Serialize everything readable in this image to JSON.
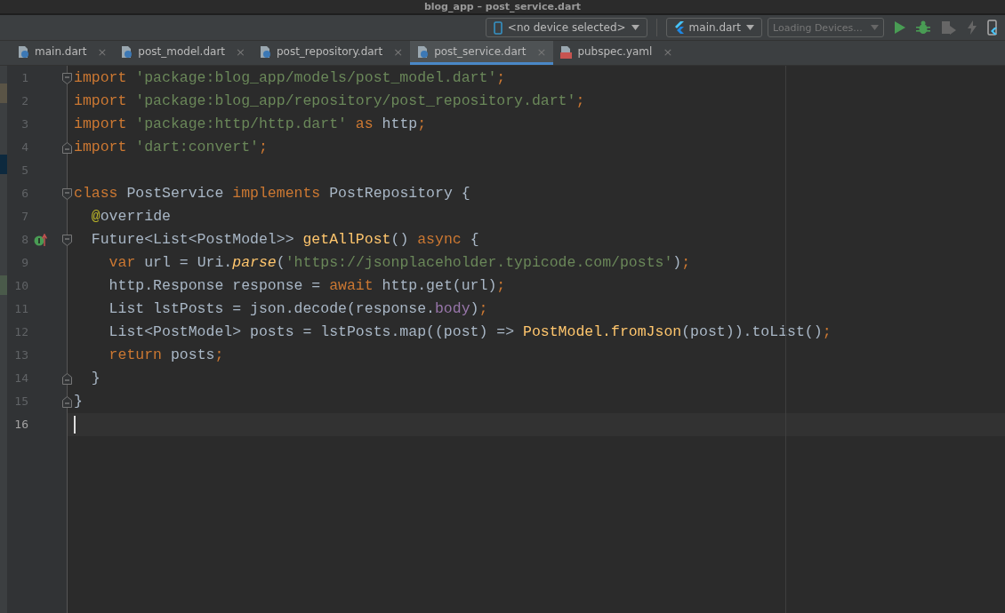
{
  "window": {
    "title": "blog_app – post_service.dart"
  },
  "toolbar": {
    "device_selector": {
      "label": "<no device selected>"
    },
    "run_config": {
      "label": "main.dart"
    },
    "device_loader": {
      "label": "Loading Devices...",
      "disabled": true
    }
  },
  "tabs": [
    {
      "label": "main.dart",
      "kind": "dart",
      "selected": false,
      "close": "×"
    },
    {
      "label": "post_model.dart",
      "kind": "dart",
      "selected": false,
      "close": "×"
    },
    {
      "label": "post_repository.dart",
      "kind": "dart",
      "selected": false,
      "close": "×"
    },
    {
      "label": "post_service.dart",
      "kind": "dart",
      "selected": true,
      "close": "×"
    },
    {
      "label": "pubspec.yaml",
      "kind": "yaml",
      "selected": false,
      "close": "×"
    }
  ],
  "code_lines": [
    {
      "number": "1",
      "current": false,
      "implements_marker": false,
      "fold_start": true,
      "fold_end": false,
      "tokens": [
        {
          "kind": "keyword",
          "text": "import "
        },
        {
          "kind": "string",
          "text": "'package:blog_app/models/post_model.dart'"
        },
        {
          "kind": "keyword",
          "text": ";"
        }
      ]
    },
    {
      "number": "2",
      "current": false,
      "implements_marker": false,
      "fold_start": false,
      "fold_end": false,
      "tokens": [
        {
          "kind": "keyword",
          "text": "import "
        },
        {
          "kind": "string",
          "text": "'package:blog_app/repository/post_repository.dart'"
        },
        {
          "kind": "keyword",
          "text": ";"
        }
      ]
    },
    {
      "number": "3",
      "current": false,
      "implements_marker": false,
      "fold_start": false,
      "fold_end": false,
      "tokens": [
        {
          "kind": "keyword",
          "text": "import "
        },
        {
          "kind": "string",
          "text": "'package:http/http.dart' "
        },
        {
          "kind": "keyword",
          "text": "as "
        },
        {
          "kind": "plain",
          "text": "http"
        },
        {
          "kind": "keyword",
          "text": ";"
        }
      ]
    },
    {
      "number": "4",
      "current": false,
      "implements_marker": false,
      "fold_start": false,
      "fold_end": true,
      "tokens": [
        {
          "kind": "keyword",
          "text": "import "
        },
        {
          "kind": "string",
          "text": "'dart:convert'"
        },
        {
          "kind": "keyword",
          "text": ";"
        }
      ]
    },
    {
      "number": "5",
      "current": false,
      "implements_marker": false,
      "fold_start": false,
      "fold_end": false
    },
    {
      "number": "6",
      "current": false,
      "implements_marker": false,
      "fold_start": true,
      "fold_end": false,
      "tokens": [
        {
          "kind": "keyword",
          "text": "class "
        },
        {
          "kind": "plain",
          "text": "PostService "
        },
        {
          "kind": "keyword",
          "text": "implements "
        },
        {
          "kind": "plain",
          "text": "PostRepository {"
        }
      ]
    },
    {
      "number": "7",
      "current": false,
      "implements_marker": false,
      "fold_start": false,
      "fold_end": false,
      "tokens": [
        {
          "kind": "annotation",
          "text": "  @"
        },
        {
          "kind": "plain",
          "text": "override"
        }
      ]
    },
    {
      "number": "8",
      "current": false,
      "implements_marker": true,
      "fold_start": true,
      "fold_end": false,
      "tokens": [
        {
          "kind": "plain",
          "text": "  Future<List<PostModel>> "
        },
        {
          "kind": "method",
          "text": "getAllPost"
        },
        {
          "kind": "plain",
          "text": "() "
        },
        {
          "kind": "keyword",
          "text": "async "
        },
        {
          "kind": "plain",
          "text": "{"
        }
      ]
    },
    {
      "number": "9",
      "current": false,
      "implements_marker": false,
      "fold_start": false,
      "fold_end": false,
      "tokens": [
        {
          "kind": "keyword",
          "text": "    var "
        },
        {
          "kind": "plain",
          "text": "url = Uri."
        },
        {
          "kind": "static_method",
          "text": "parse"
        },
        {
          "kind": "plain",
          "text": "("
        },
        {
          "kind": "string",
          "text": "'https://jsonplaceholder.typicode.com/posts'"
        },
        {
          "kind": "plain",
          "text": ")"
        },
        {
          "kind": "keyword",
          "text": ";"
        }
      ]
    },
    {
      "number": "10",
      "current": false,
      "implements_marker": false,
      "fold_start": false,
      "fold_end": false,
      "tokens": [
        {
          "kind": "plain",
          "text": "    http.Response response = "
        },
        {
          "kind": "keyword",
          "text": "await "
        },
        {
          "kind": "plain",
          "text": "http.get(url)"
        },
        {
          "kind": "keyword",
          "text": ";"
        }
      ]
    },
    {
      "number": "11",
      "current": false,
      "implements_marker": false,
      "fold_start": false,
      "fold_end": false,
      "tokens": [
        {
          "kind": "plain",
          "text": "    List lstPosts = json.decode(response."
        },
        {
          "kind": "field",
          "text": "body"
        },
        {
          "kind": "plain",
          "text": ")"
        },
        {
          "kind": "keyword",
          "text": ";"
        }
      ]
    },
    {
      "number": "12",
      "current": false,
      "implements_marker": false,
      "fold_start": false,
      "fold_end": false,
      "tokens": [
        {
          "kind": "plain",
          "text": "    List<PostModel> posts = lstPosts.map((post) => "
        },
        {
          "kind": "method",
          "text": "PostModel.fromJson"
        },
        {
          "kind": "plain",
          "text": "(post)).toList()"
        },
        {
          "kind": "keyword",
          "text": ";"
        }
      ]
    },
    {
      "number": "13",
      "current": false,
      "implements_marker": false,
      "fold_start": false,
      "fold_end": false,
      "tokens": [
        {
          "kind": "keyword",
          "text": "    return "
        },
        {
          "kind": "plain",
          "text": "posts"
        },
        {
          "kind": "keyword",
          "text": ";"
        }
      ]
    },
    {
      "number": "14",
      "current": false,
      "implements_marker": false,
      "fold_start": false,
      "fold_end": true,
      "tokens": [
        {
          "kind": "plain",
          "text": "  }"
        }
      ]
    },
    {
      "number": "15",
      "current": false,
      "implements_marker": false,
      "fold_start": false,
      "fold_end": true,
      "tokens": [
        {
          "kind": "plain",
          "text": "}"
        }
      ]
    },
    {
      "number": "16",
      "current": true,
      "implements_marker": false,
      "fold_start": false,
      "fold_end": false
    }
  ]
}
